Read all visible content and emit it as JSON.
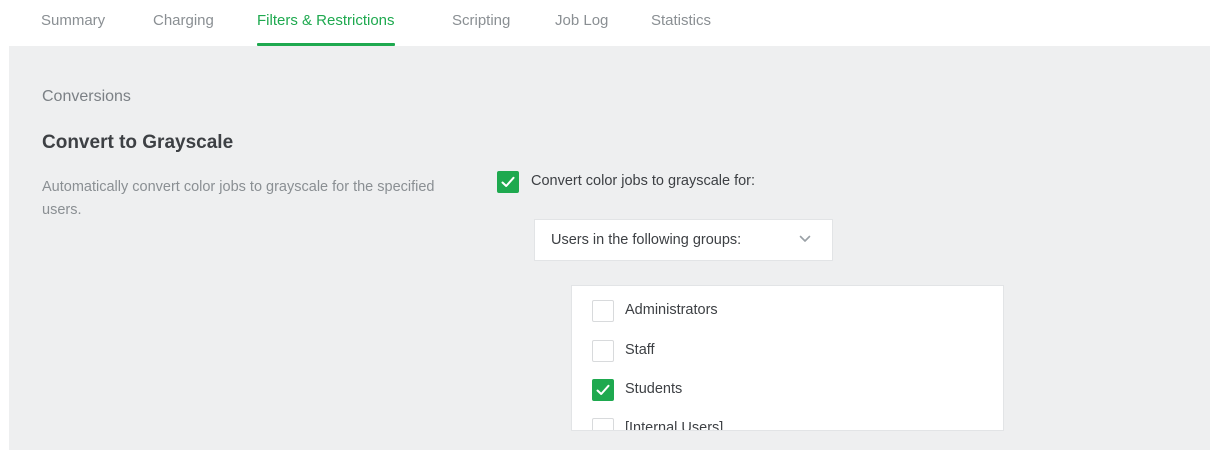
{
  "tabs": [
    {
      "label": "Summary",
      "active": false
    },
    {
      "label": "Charging",
      "active": false
    },
    {
      "label": "Filters & Restrictions",
      "active": true
    },
    {
      "label": "Scripting",
      "active": false
    },
    {
      "label": "Job Log",
      "active": false
    },
    {
      "label": "Statistics",
      "active": false
    }
  ],
  "section": {
    "label": "Conversions"
  },
  "setting": {
    "title": "Convert to Grayscale",
    "description": "Automatically convert color jobs to grayscale for the specified users.",
    "main_checkbox_label": "Convert color jobs to grayscale for:",
    "main_checkbox_checked": true,
    "dropdown_value": "Users in the following groups:"
  },
  "groups": [
    {
      "label": "Administrators",
      "checked": false
    },
    {
      "label": "Staff",
      "checked": false
    },
    {
      "label": "Students",
      "checked": true
    },
    {
      "label": "[Internal Users]",
      "checked": false
    }
  ],
  "colors": {
    "accent": "#1ea94f",
    "panel_bg": "#eeeff0",
    "muted_text": "#8a8f93",
    "body_text": "#3d4044"
  },
  "icons": {
    "check": "check-icon",
    "dropdown": "chevron-down-icon"
  }
}
